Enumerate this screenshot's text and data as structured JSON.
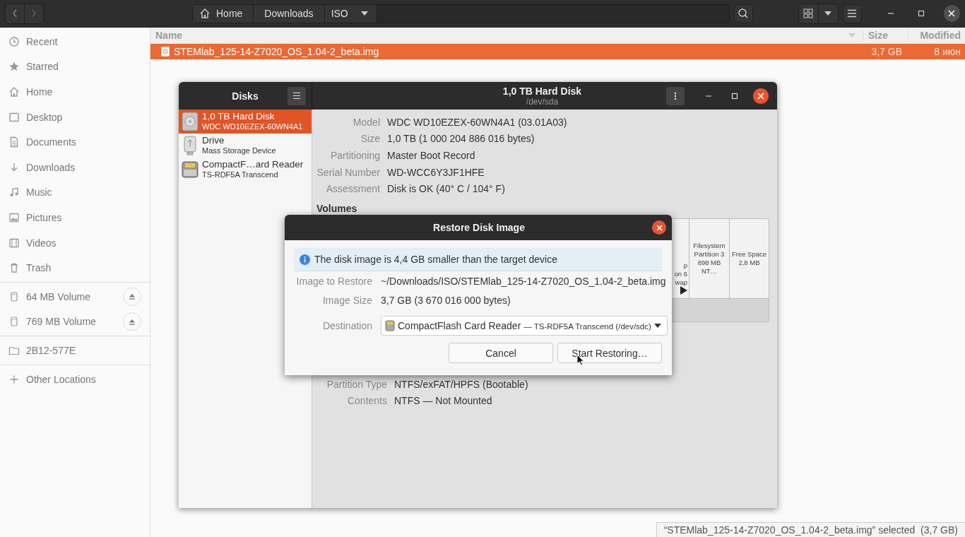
{
  "file_manager": {
    "path": [
      {
        "label": "Home",
        "kind": "home"
      },
      {
        "label": "Downloads",
        "kind": "plain"
      },
      {
        "label": "ISO",
        "kind": "dropdown"
      }
    ],
    "sidebar": [
      [
        {
          "label": "Recent",
          "kind": "recent"
        },
        {
          "label": "Starred",
          "kind": "star"
        },
        {
          "label": "Home",
          "kind": "home"
        },
        {
          "label": "Desktop",
          "kind": "desktop"
        },
        {
          "label": "Documents",
          "kind": "document"
        },
        {
          "label": "Downloads",
          "kind": "download"
        },
        {
          "label": "Music",
          "kind": "music"
        },
        {
          "label": "Pictures",
          "kind": "picture"
        },
        {
          "label": "Videos",
          "kind": "video"
        },
        {
          "label": "Trash",
          "kind": "trash"
        }
      ],
      [
        {
          "label": "64 MB Volume",
          "kind": "volume"
        },
        {
          "label": "769 MB Volume",
          "kind": "volume"
        }
      ],
      [
        {
          "label": "2B12-577E",
          "kind": "folder"
        }
      ],
      [
        {
          "label": "Other Locations",
          "kind": "plus"
        }
      ]
    ],
    "columns": [
      "Name",
      "Size",
      "Modified"
    ],
    "files": [
      {
        "name": "STEMlab_125-14-Z7020_OS_1.04-2_beta.img",
        "size": "3,7 GB",
        "modified": "8 июн",
        "selected": true
      }
    ],
    "status": "“STEMlab_125-14-Z7020_OS_1.04-2_beta.img” selected  (3,7 GB)"
  },
  "disks": {
    "title": "Disks",
    "devices": [
      {
        "name": "1,0 TB Hard Disk",
        "description": "WDC WD10EZEX-60WN4A1",
        "kind": "hdd",
        "selected": true
      },
      {
        "name": "Drive",
        "description": "Mass Storage Device",
        "kind": "usb",
        "selected": false
      },
      {
        "name": "CompactF…ard Reader",
        "description": "TS-RDF5A Transcend",
        "kind": "card",
        "selected": false
      }
    ],
    "heading": "1,0 TB Hard Disk",
    "subheading": "/dev/sda",
    "properties": [
      {
        "label": "Model",
        "value": "WDC WD10EZEX-60WN4A1 (03.01A03)"
      },
      {
        "label": "Size",
        "value": "1,0 TB (1 000 204 886 016 bytes)"
      },
      {
        "label": "Partitioning",
        "value": "Master Boot Record"
      },
      {
        "label": "Serial Number",
        "value": "WD-WCC6Y3JF1HFE"
      },
      {
        "label": "Assessment",
        "value": "Disk is OK (40° C / 104° F)"
      }
    ],
    "volumes_label": "Volumes",
    "partitions": [
      {
        "lines": [
          "p",
          "on 6",
          "wap"
        ],
        "kind": "partial"
      },
      {
        "lines": [
          "Filesystem",
          "Partition 3",
          "898 MB NT…"
        ],
        "kind": "full"
      },
      {
        "lines": [
          "Free Space",
          "2,8 MB"
        ],
        "kind": "full"
      }
    ],
    "volume_properties": [
      {
        "label": "Partition Type",
        "value": "NTFS/exFAT/HPFS (Bootable)"
      },
      {
        "label": "Contents",
        "value": "NTFS — Not Mounted"
      }
    ]
  },
  "dialog": {
    "title": "Restore Disk Image",
    "info": "The disk image is 4,4 GB smaller than the target device",
    "fields": [
      {
        "label": "Image to Restore",
        "value": "~/Downloads/ISO/STEMlab_125-14-Z7020_OS_1.04-2_beta.img"
      },
      {
        "label": "Image Size",
        "value": "3,7 GB (3 670 016 000 bytes)"
      }
    ],
    "destination": {
      "label": "Destination",
      "device": "CompactFlash Card Reader",
      "detail": "— TS-RDF5A Transcend (/dev/sdc)"
    },
    "buttons": [
      "Cancel",
      "Start Restoring…"
    ]
  }
}
